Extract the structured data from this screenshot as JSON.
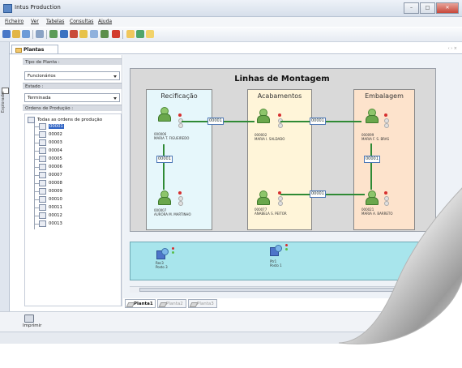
{
  "window": {
    "title": "Intus Production",
    "buttons": [
      "–",
      "□",
      "✕"
    ]
  },
  "menu": {
    "items": [
      "Ficheiro",
      "Ver",
      "Tabelas",
      "Consultas",
      "Ajuda"
    ]
  },
  "toolbar": {
    "icons": [
      "save-icon",
      "open-icon",
      "grid-icon",
      "copy-icon",
      "chart-icon",
      "tools-icon",
      "settings-icon",
      "edit-icon",
      "export-icon",
      "zoom-icon",
      "help-icon"
    ]
  },
  "sidebar": {
    "strip_label": "Explorador"
  },
  "document": {
    "tab_label": "Plantas",
    "header_right": "‹ ›  ×"
  },
  "filters": {
    "plant_type_label": "Tipo de Planta :",
    "plant_type_value": "Funcionários",
    "status_label": "Estado :",
    "status_value": "Terminada",
    "orders_label": "Ordens de Produção :",
    "tree_root": "Todas as ordens de produção",
    "orders": [
      "00001",
      "00002",
      "00003",
      "00004",
      "00005",
      "00006",
      "00007",
      "00008",
      "00009",
      "00010",
      "00011",
      "00012",
      "00013"
    ],
    "selected_order": "00001"
  },
  "diagram": {
    "title": "Linhas de Montagem",
    "stations": [
      {
        "name": "Recificação",
        "color": "#e6f7fb"
      },
      {
        "name": "Acabamentos",
        "color": "#fff5d9"
      },
      {
        "name": "Embalagem",
        "color": "#fde3cc"
      }
    ],
    "workers": [
      {
        "code": "000006",
        "name": "MARIA T. FIGUEIREDO"
      },
      {
        "code": "000007",
        "name": "AURORA M. MARTINHO"
      },
      {
        "code": "000002",
        "name": "MARIA I. SALDADO"
      },
      {
        "code": "000077",
        "name": "ANABELA S. PEITOR"
      },
      {
        "code": "000099",
        "name": "MARIA F. S. BRAS"
      },
      {
        "code": "000021",
        "name": "MARIA A. BARRETO"
      }
    ],
    "flow_labels": [
      "00001",
      "00001",
      "00001",
      "00001",
      "00001"
    ]
  },
  "machines": [
    {
      "code": "Rec3",
      "name": "Posto 3"
    },
    {
      "code": "Ptr1",
      "name": "Posto 1"
    }
  ],
  "sheets": {
    "tabs": [
      "Planta1",
      "Planta2",
      "Planta3"
    ],
    "active": "Planta1"
  },
  "bottom": {
    "print_label": "Imprimir"
  },
  "colors": {
    "accent": "#3164c4",
    "connector": "#2f8a35",
    "machine_area": "#a8e5ec"
  }
}
